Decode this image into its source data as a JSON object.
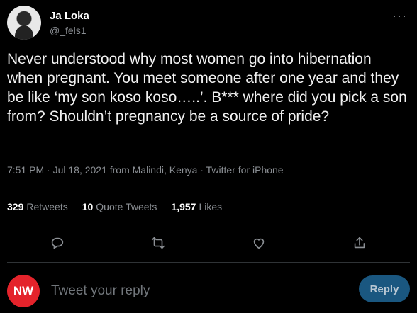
{
  "author": {
    "name": "Ja Loka",
    "handle": "@_fels1"
  },
  "more_icon": "more-dots-icon",
  "tweet": {
    "text": "Never understood why most women go into hibernation when pregnant. You meet someone after one year and they be like ‘my son koso koso…..’. B*** where did you pick a son from? Shouldn’t pregnancy be a source of pride?",
    "meta": "7:51 PM · Jul 18, 2021 from Malindi, Kenya · Twitter for iPhone"
  },
  "stats": {
    "retweets_count": "329",
    "retweets_label": "Retweets",
    "quotes_count": "10",
    "quotes_label": "Quote Tweets",
    "likes_count": "1,957",
    "likes_label": "Likes"
  },
  "actions": [
    "reply-icon",
    "retweet-icon",
    "like-icon",
    "share-icon"
  ],
  "reply_box": {
    "logo_text": "NW",
    "placeholder": "Tweet your reply",
    "button_label": "Reply"
  },
  "colors": {
    "background": "#000000",
    "muted": "#8b8f94",
    "accent": "#1d9bf0",
    "logo": "#e4232b"
  }
}
